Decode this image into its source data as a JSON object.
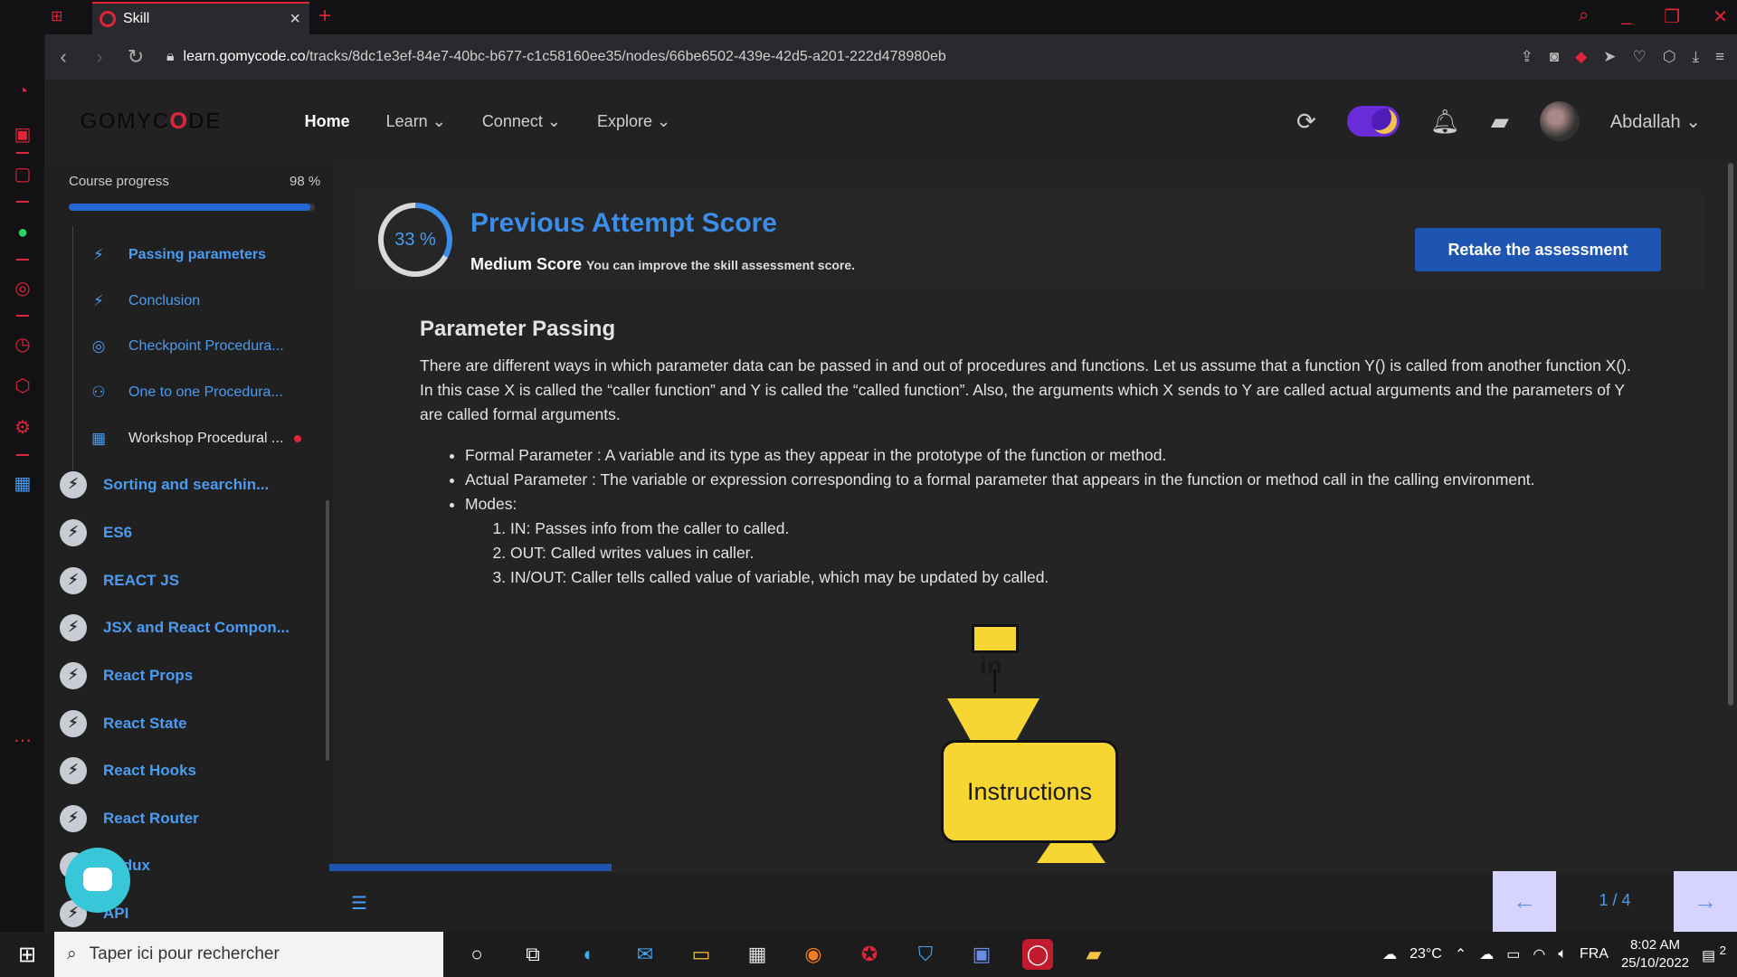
{
  "browser": {
    "tab_title": "Skill",
    "url_host": "learn.gomycode.co",
    "url_path": "/tracks/8dc1e3ef-84e7-40bc-b677-c1c58160ee35/nodes/66be6502-439e-42d5-a201-222d478980eb"
  },
  "header": {
    "brand_pre": "GOMYC",
    "brand_o": "O",
    "brand_post": "DE",
    "nav": [
      "Home",
      "Learn",
      "Connect",
      "Explore"
    ],
    "username": "Abdallah"
  },
  "sidebar": {
    "progress_label": "Course progress",
    "progress_value": "98 %",
    "progress_fraction": 0.98,
    "sub_items": [
      {
        "label": "Passing parameters",
        "icon": "bolt-icon"
      },
      {
        "label": "Conclusion",
        "icon": "bolt-icon"
      },
      {
        "label": "Checkpoint Procedura...",
        "icon": "target-icon"
      },
      {
        "label": "One to one Procedura...",
        "icon": "people-icon"
      },
      {
        "label": "Workshop Procedural ...",
        "icon": "workshop-icon"
      }
    ],
    "modules": [
      "Sorting and searchin...",
      "ES6",
      "REACT JS",
      "JSX and React Compon...",
      "React Props",
      "React State",
      "React Hooks",
      "React Router",
      "Redux",
      "API"
    ]
  },
  "score": {
    "percent": "33 %",
    "fraction": 0.33,
    "title": "Previous Attempt Score",
    "level": "Medium Score",
    "hint": "You can improve the skill assessment score.",
    "retake_label": "Retake the assessment"
  },
  "lesson": {
    "heading": "Parameter Passing",
    "intro": "There are different ways in which parameter data can be passed in and out of procedures and functions. Let us assume that a function Y() is called from another function X(). In this case X is called the “caller function” and Y is called the “called function”. Also, the arguments which X sends to Y are called actual arguments and the parameters of Y are called formal arguments.",
    "bullets": [
      "Formal Parameter : A variable and its type as they appear in the prototype of the function or method.",
      "Actual Parameter : The variable or expression corresponding to a formal parameter that appears in the function or method call in the calling environment.",
      "Modes:"
    ],
    "modes": [
      "IN: Passes info from the caller to called.",
      "OUT: Called writes values in caller.",
      "IN/OUT: Caller tells called value of variable, which may be updated by called."
    ],
    "diagram_in": "in",
    "diagram_box": "Instructions"
  },
  "pager": {
    "count": "1 / 4"
  },
  "taskbar": {
    "search_placeholder": "Taper ici pour rechercher",
    "temperature": "23°C",
    "lang": "FRA",
    "time": "8:02 AM",
    "date": "25/10/2022",
    "notif_count": "2"
  },
  "colors": {
    "accent": "#3a8de8",
    "brand_red": "#e0253a",
    "retake": "#1e55b3"
  }
}
